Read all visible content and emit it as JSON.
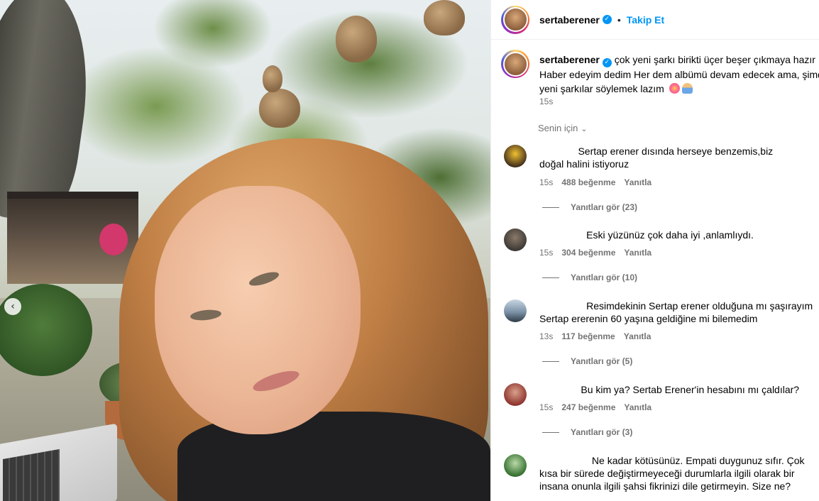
{
  "post": {
    "username": "sertaberener",
    "follow_label": "Takip Et",
    "dot": "•",
    "verified_glyph": "✓"
  },
  "caption": {
    "username": "sertaberener",
    "line1": "çok yeni şarkı birikti üçer beşer çıkmaya hazır .",
    "line2": "Haber edeyim dedim Her dem albümü devam edecek ama, şimdi",
    "line3": "yeni şarkılar söylemek lazım",
    "emojis": [
      "flower-emoji",
      "person-emoji"
    ],
    "time": "15s"
  },
  "filter_label": "Senin için",
  "carousel_prev_glyph": "‹",
  "comments": [
    {
      "text": "              Sertap erener dısında herseye benzemis,biz\ndoğal halini istiyoruz",
      "time": "15s",
      "likes": "488 beğenme",
      "reply": "Yanıtla",
      "view_replies": "Yanıtları gör (23)"
    },
    {
      "text": "                 Eski yüzünüz çok daha iyi ,anlamlıydı.",
      "time": "15s",
      "likes": "304 beğenme",
      "reply": "Yanıtla",
      "view_replies": "Yanıtları gör (10)"
    },
    {
      "text": "                 Resimdekinin Sertap erener olduğuna mı şaşırayım\nSertap ererenin 60 yaşına geldiğine mi bilemedim",
      "time": "13s",
      "likes": "117 beğenme",
      "reply": "Yanıtla",
      "view_replies": "Yanıtları gör (5)"
    },
    {
      "text": "               Bu kim ya? Sertab Erener'in hesabını mı çaldılar?",
      "time": "15s",
      "likes": "247 beğenme",
      "reply": "Yanıtla",
      "view_replies": "Yanıtları gör (3)"
    },
    {
      "text": "                   Ne kadar kötüsünüz. Empati duygunuz sıfır. Çok\nkısa bir sürede değiştirmeyeceği durumlarla ilgili olarak bir\ninsana onunla ilgili şahsi fikrinizi dile getirmeyin. Size ne?",
      "time": "",
      "likes": "",
      "reply": "",
      "view_replies": ""
    }
  ],
  "colors": {
    "link_blue": "#0095f6",
    "secondary_text": "#737373",
    "border": "#efefef"
  }
}
